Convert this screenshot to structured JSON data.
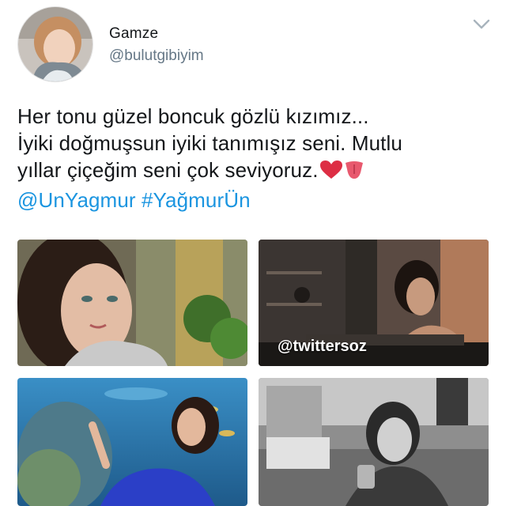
{
  "user": {
    "display_name": "Gamze",
    "handle": "@bulutgibiyim",
    "avatar_icon": "profile-photo"
  },
  "tweet": {
    "line1": "Her tonu güzel boncuk gözlü kızımız...",
    "line2": "İyiki doğmuşsun iyiki tanımışız seni. Mutlu",
    "line3": "yıllar çiçeğim seni çok seviyoruz.",
    "mention": "@UnYagmur",
    "hashtag": "#YağmurÜn",
    "emojis": [
      "red-heart",
      "tongue"
    ]
  },
  "photos": {
    "watermark": "@twittersoz"
  },
  "colors": {
    "link": "#1b95e0",
    "text": "#14171a",
    "secondary": "#657786"
  },
  "menu_icon": "chevron-down-icon"
}
